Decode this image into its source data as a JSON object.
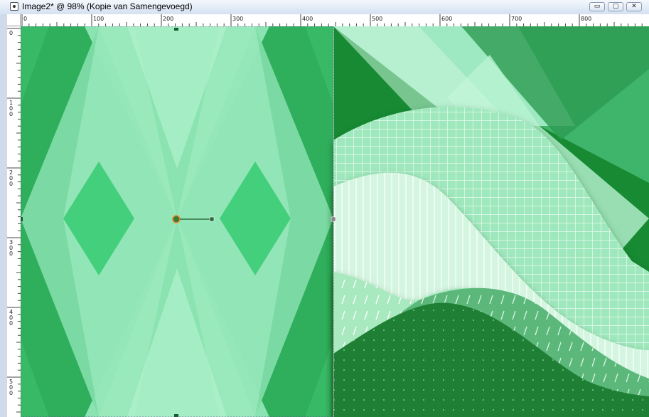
{
  "window": {
    "title": "Image2* @  98% (Kopie van Samengevoegd)",
    "buttons": {
      "minimize": "▭",
      "maximize": "▢",
      "close": "✕"
    }
  },
  "ruler": {
    "top_labels": [
      "0",
      "100",
      "200",
      "300",
      "400",
      "500",
      "600",
      "700",
      "800"
    ],
    "left_labels": [
      "0",
      "100",
      "200",
      "300",
      "400",
      "500"
    ]
  },
  "colors": {
    "dark_green": "#14822e",
    "mid_green": "#4fc880",
    "light_green": "#8fe6b4",
    "pale_green": "#c6f2d8"
  }
}
